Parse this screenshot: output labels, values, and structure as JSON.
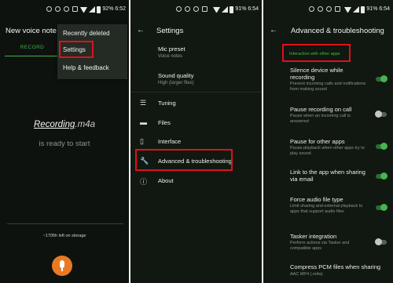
{
  "screens": [
    {
      "status": {
        "battery": "92%",
        "time": "6:52"
      },
      "title": "New voice note",
      "tab_label": "RECORD",
      "overflow_menu": [
        "Recently deleted",
        "Settings",
        "Help & feedback"
      ],
      "file_name": "Recording",
      "file_ext": ".m4a",
      "status_text": "is ready to start",
      "storage_text": "~1705h left on storage",
      "highlight": "Settings"
    },
    {
      "status": {
        "battery": "91%",
        "time": "6:54"
      },
      "title": "Settings",
      "rows": [
        {
          "title": "Mic preset",
          "subtitle": "Voice notes"
        },
        {
          "title": "Sound quality",
          "subtitle": "High (larger files)"
        }
      ],
      "nav": [
        {
          "label": "Tuning",
          "icon": "sliders-icon"
        },
        {
          "label": "Files",
          "icon": "folder-icon"
        },
        {
          "label": "Interface",
          "icon": "phone-icon"
        },
        {
          "label": "Advanced & troubleshooting",
          "icon": "wrench-icon"
        },
        {
          "label": "About",
          "icon": "info-icon"
        }
      ],
      "highlight": "Advanced & troubleshooting"
    },
    {
      "status": {
        "battery": "91%",
        "time": "6:54"
      },
      "title": "Advanced & troubleshooting",
      "section": "Interaction with other apps",
      "options": [
        {
          "title": "Silence device while recording",
          "subtitle": "Prevent incoming calls and notifications from making sound",
          "on": true
        },
        {
          "title": "Pause recording on call",
          "subtitle": "Pause when an incoming call is answered",
          "on": false
        },
        {
          "title": "Pause for other apps",
          "subtitle": "Pause playback when other apps try to play sound",
          "on": true
        },
        {
          "title": "Link to the app when sharing via email",
          "subtitle": "",
          "on": true
        },
        {
          "title": "Force audio file type",
          "subtitle": "Limit sharing and external playback to apps that support audio files",
          "on": true
        },
        {
          "title": "Tasker integration",
          "subtitle": "Perform actions via Tasker and compatible apps",
          "on": false
        },
        {
          "title": "Compress PCM files when sharing",
          "subtitle": "AAC MP4 (.m4a)",
          "on": null
        }
      ]
    }
  ],
  "colors": {
    "accent": "#3cb446",
    "highlight_border": "#e0101b",
    "fab": "#e97a24"
  }
}
